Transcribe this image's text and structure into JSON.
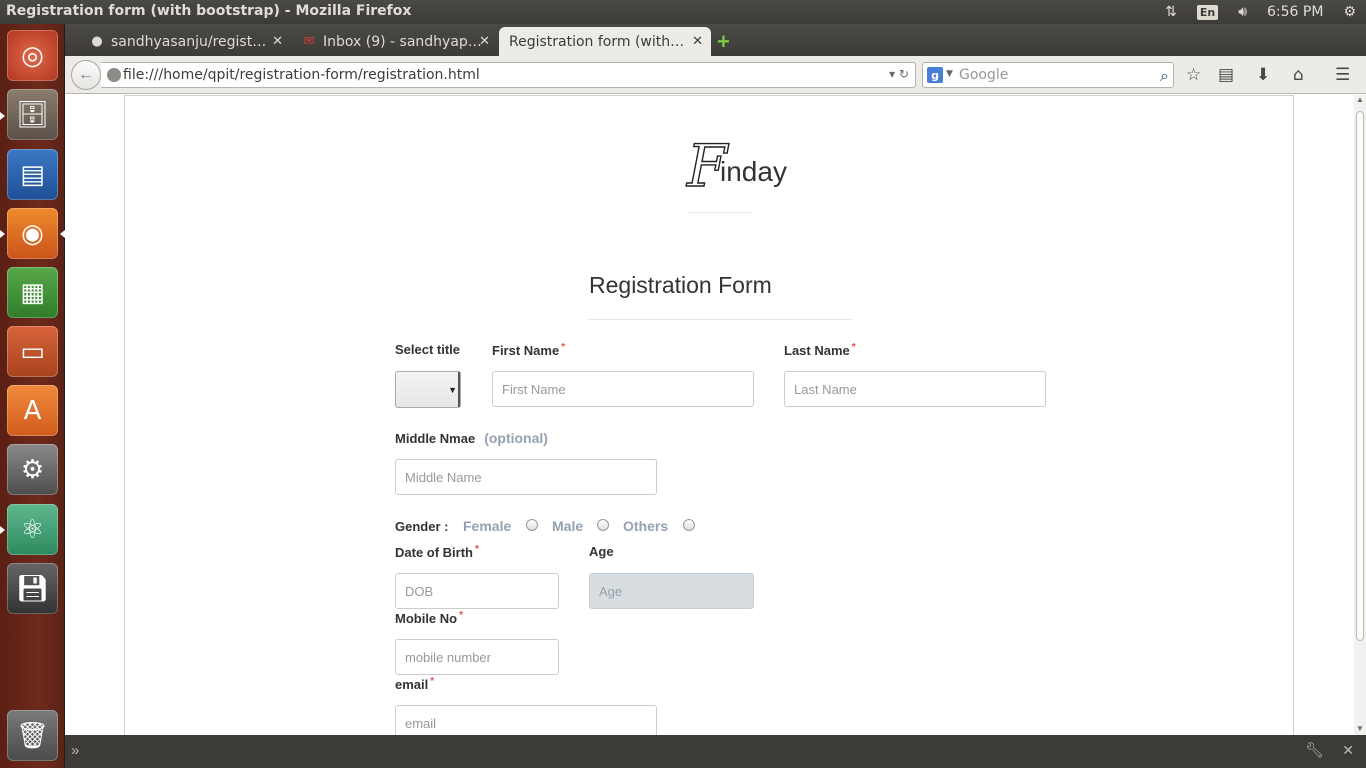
{
  "window": {
    "title": "Registration form (with bootstrap) - Mozilla Firefox"
  },
  "top_panel": {
    "network_icon": "network-arrows-icon",
    "lang": "En",
    "time": "6:56 PM"
  },
  "launcher": {
    "items": [
      "dash-home-icon",
      "files-icon",
      "writer-icon",
      "firefox-icon",
      "calc-icon",
      "impress-icon",
      "software-center-icon",
      "system-settings-icon",
      "atom-icon",
      "save-disk-icon",
      "trash-icon"
    ]
  },
  "tabs": [
    {
      "label": "sandhyasanju/regist…",
      "icon": "github-icon"
    },
    {
      "label": "Inbox (9) - sandhyap…",
      "icon": "gmail-icon"
    },
    {
      "label": "Registration form (with…",
      "icon": "",
      "active": true
    }
  ],
  "nav": {
    "url": "file:///home/qpit/registration-form/registration.html",
    "search_placeholder": "Google"
  },
  "page": {
    "logo_f": "F",
    "logo_rest": "inday",
    "form_title": "Registration Form",
    "select_title_label": "Select title",
    "first_name_label": "First Name",
    "first_name_placeholder": "First Name",
    "last_name_label": "Last Name",
    "last_name_placeholder": "Last Name",
    "middle_name_label": "Middle Nmae",
    "middle_name_optional": "(optional)",
    "middle_name_placeholder": "Middle Name",
    "gender_label": "Gender :",
    "gender_options": [
      "Female",
      "Male",
      "Others"
    ],
    "dob_label": "Date of Birth",
    "dob_placeholder": "DOB",
    "age_label": "Age",
    "age_placeholder": "Age",
    "mobile_label": "Mobile No",
    "mobile_placeholder": "mobile number",
    "email_label": "email",
    "email_placeholder": "email",
    "required_mark": "*"
  },
  "colors": {
    "required": "#d9534f",
    "muted": "#93a1b1",
    "launcher_bg": "#6e2a1b"
  }
}
